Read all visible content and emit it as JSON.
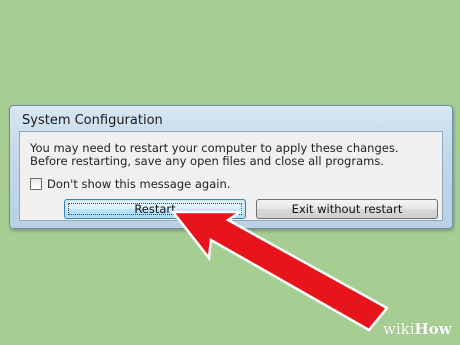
{
  "dialog": {
    "title": "System Configuration",
    "message_line1": "You may need to restart your computer to apply these changes.",
    "message_line2": "Before restarting, save any open files and close all programs.",
    "checkbox_label": "Don't show this message again.",
    "checkbox_checked": false,
    "restart_label": "Restart",
    "exit_label": "Exit without restart"
  },
  "annotation": {
    "arrow_color": "#e8141b",
    "arrow_target": "restart-button"
  },
  "watermark": {
    "wiki": "wiki",
    "how": "How"
  },
  "colors": {
    "background": "#a6cd92",
    "accent": "#e8141b"
  }
}
